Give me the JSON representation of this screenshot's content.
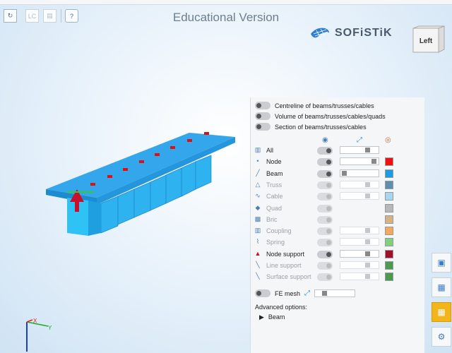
{
  "toolbar": {
    "refresh_icon": "refresh-icon",
    "lc_label": "LC",
    "save_icon": "save-icon",
    "help_label": "?"
  },
  "header": {
    "title": "Educational Version"
  },
  "brand": {
    "name": "SOFiSTiK"
  },
  "view_cube": {
    "face_label": "Left"
  },
  "panel": {
    "visibility_toggles": [
      {
        "label": "Centreline of beams/trusses/cables"
      },
      {
        "label": "Volume of beams/trusses/cables/quads"
      },
      {
        "label": "Section of beams/trusses/cables"
      }
    ],
    "column_icons": [
      "eye-icon",
      "expand-icon",
      "color-icon"
    ],
    "objects": [
      {
        "label": "All",
        "enabled": true,
        "slider": 0.75,
        "color": ""
      },
      {
        "label": "Node",
        "enabled": true,
        "slider": 0.95,
        "color": "#ee1111"
      },
      {
        "label": "Beam",
        "enabled": true,
        "slider": 0.05,
        "color": "#1a9be6"
      },
      {
        "label": "Truss",
        "enabled": false,
        "slider": 0.75,
        "color": "#5c8fb0"
      },
      {
        "label": "Cable",
        "enabled": false,
        "slider": 0.75,
        "color": "#a6d6f0"
      },
      {
        "label": "Quad",
        "enabled": false,
        "slider": null,
        "color": "#b8b8b8"
      },
      {
        "label": "Bric",
        "enabled": false,
        "slider": null,
        "color": "#d8b088"
      },
      {
        "label": "Coupling",
        "enabled": false,
        "slider": 0.75,
        "color": "#f3a860"
      },
      {
        "label": "Spring",
        "enabled": false,
        "slider": 0.75,
        "color": "#7fd07f"
      },
      {
        "label": "Node support",
        "enabled": true,
        "slider": 0.75,
        "color": "#a0102a"
      },
      {
        "label": "Line support",
        "enabled": false,
        "slider": 0.75,
        "color": "#4a9a50"
      },
      {
        "label": "Surface support",
        "enabled": false,
        "slider": 0.75,
        "color": "#4a9a50"
      }
    ],
    "fe_mesh": {
      "label": "FE mesh",
      "slider": 0.2
    },
    "advanced": {
      "label": "Advanced options:",
      "item": "Beam"
    }
  },
  "axes": {
    "x": "X",
    "y": "Y"
  },
  "side_buttons": [
    "camera-icon",
    "image-icon",
    "grid-icon",
    "settings-icon"
  ]
}
